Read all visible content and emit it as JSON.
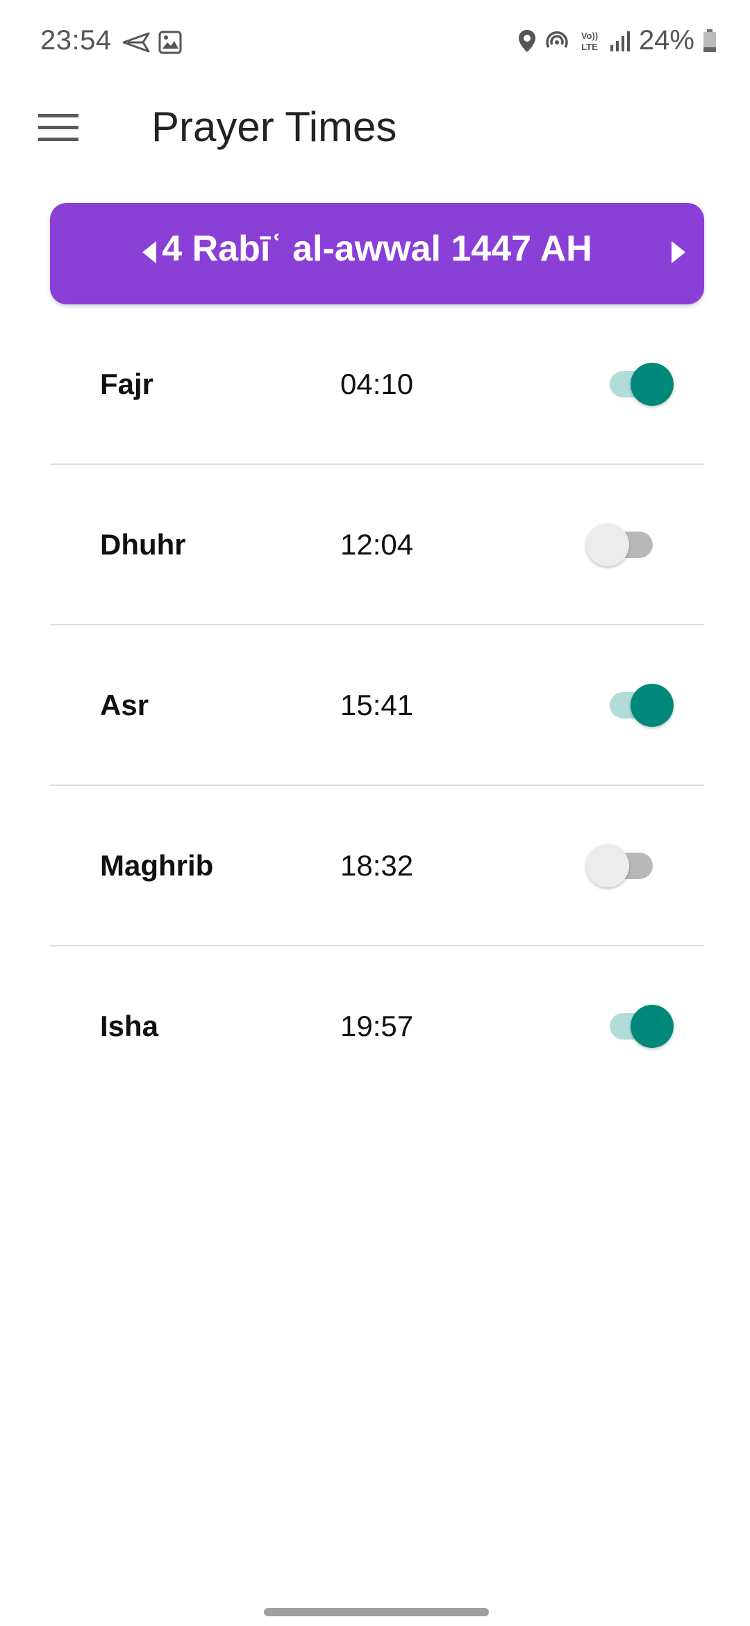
{
  "status_bar": {
    "time": "23:54",
    "battery_percent": "24%",
    "left_icons": [
      "send-icon",
      "image-icon"
    ],
    "right_icons": [
      "location-icon",
      "hotspot-icon",
      "volte-icon",
      "signal-icon",
      "battery-icon"
    ],
    "volte_text_top": "Vo))",
    "volte_text_bottom": "LTE"
  },
  "app_bar": {
    "title": "Prayer Times",
    "menu_icon": "menu-icon"
  },
  "date_selector": {
    "label": "4 Rabīʿ al-awwal 1447 AH",
    "prev_icon": "arrow-left-icon",
    "next_icon": "arrow-right-icon"
  },
  "prayers": [
    {
      "name": "Fajr",
      "time": "04:10",
      "enabled": true
    },
    {
      "name": "Dhuhr",
      "time": "12:04",
      "enabled": false
    },
    {
      "name": "Asr",
      "time": "15:41",
      "enabled": true
    },
    {
      "name": "Maghrib",
      "time": "18:32",
      "enabled": false
    },
    {
      "name": "Isha",
      "time": "19:57",
      "enabled": true
    }
  ],
  "colors": {
    "date_bar": "#8a3fd6",
    "toggle_on_thumb": "#00897b",
    "toggle_on_track": "#b2dcd7",
    "toggle_off_thumb": "#ececec",
    "toggle_off_track": "#b8b8b8"
  }
}
